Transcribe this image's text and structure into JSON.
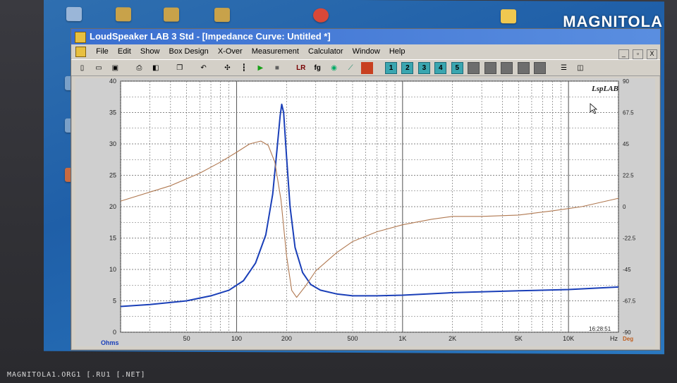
{
  "watermark": "MAGNITOLA",
  "footer_url": "MAGNITOLA1.ORG1 [.RU1 [.NET]",
  "window": {
    "title": "LoudSpeaker LAB 3 Std - [Impedance Curve: Untitled *]"
  },
  "menu": {
    "items": [
      "File",
      "Edit",
      "Show",
      "Box Design",
      "X-Over",
      "Measurement",
      "Calculator",
      "Window",
      "Help"
    ]
  },
  "mdi_controls": [
    "_",
    "▫",
    "X"
  ],
  "toolbar": {
    "number_buttons": [
      "1",
      "2",
      "3",
      "4",
      "5"
    ],
    "fg_label": "fg"
  },
  "colors": {
    "impedance": "#1a3fb8",
    "phase": "#b07850",
    "grid": "#606060",
    "plot_bg": "#ffffff"
  },
  "chart_data": {
    "type": "line",
    "title": "",
    "logo": "LspLAB",
    "xlabel": "Hz",
    "ylabel_left": "Ohms",
    "ylabel_right": "Deg",
    "x_scale": "log",
    "xlim": [
      20,
      20000
    ],
    "ylim": [
      0,
      40
    ],
    "y2lim": [
      -90,
      90
    ],
    "x_tick_labels": [
      "50",
      "100",
      "200",
      "500",
      "1K",
      "2K",
      "5K",
      "10K"
    ],
    "y_tick_labels": [
      "0",
      "5",
      "10",
      "15",
      "20",
      "25",
      "30",
      "35",
      "40"
    ],
    "y2_tick_labels": [
      "-90",
      "-67.5",
      "-45",
      "-22.5",
      "0",
      "22.5",
      "45",
      "67.5",
      "90"
    ],
    "timestamp": "16:28:51",
    "grid": true,
    "series": [
      {
        "name": "",
        "axis": "left",
        "points": [
          [
            20,
            4.1
          ],
          [
            30,
            4.4
          ],
          [
            50,
            5.0
          ],
          [
            70,
            5.8
          ],
          [
            90,
            6.7
          ],
          [
            110,
            8.2
          ],
          [
            130,
            11.0
          ],
          [
            150,
            15.5
          ],
          [
            165,
            22.0
          ],
          [
            175,
            29.0
          ],
          [
            183,
            34.5
          ],
          [
            187,
            36.3
          ],
          [
            192,
            35.0
          ],
          [
            200,
            28.0
          ],
          [
            210,
            20.0
          ],
          [
            225,
            13.5
          ],
          [
            250,
            9.5
          ],
          [
            280,
            7.6
          ],
          [
            320,
            6.7
          ],
          [
            400,
            6.1
          ],
          [
            500,
            5.8
          ],
          [
            700,
            5.8
          ],
          [
            1000,
            5.9
          ],
          [
            2000,
            6.3
          ],
          [
            5000,
            6.6
          ],
          [
            10000,
            6.8
          ],
          [
            20000,
            7.2
          ]
        ]
      },
      {
        "name": "",
        "axis": "right",
        "points": [
          [
            20,
            4
          ],
          [
            40,
            15
          ],
          [
            60,
            24
          ],
          [
            80,
            32
          ],
          [
            100,
            39
          ],
          [
            120,
            45
          ],
          [
            140,
            47
          ],
          [
            155,
            44
          ],
          [
            170,
            32
          ],
          [
            185,
            5
          ],
          [
            200,
            -35
          ],
          [
            215,
            -60
          ],
          [
            230,
            -65
          ],
          [
            260,
            -57
          ],
          [
            300,
            -46
          ],
          [
            400,
            -33
          ],
          [
            500,
            -25
          ],
          [
            700,
            -18
          ],
          [
            1000,
            -13
          ],
          [
            1500,
            -9
          ],
          [
            2000,
            -7
          ],
          [
            3000,
            -7
          ],
          [
            5000,
            -6
          ],
          [
            8000,
            -3
          ],
          [
            12000,
            0
          ],
          [
            20000,
            6
          ]
        ]
      }
    ]
  }
}
